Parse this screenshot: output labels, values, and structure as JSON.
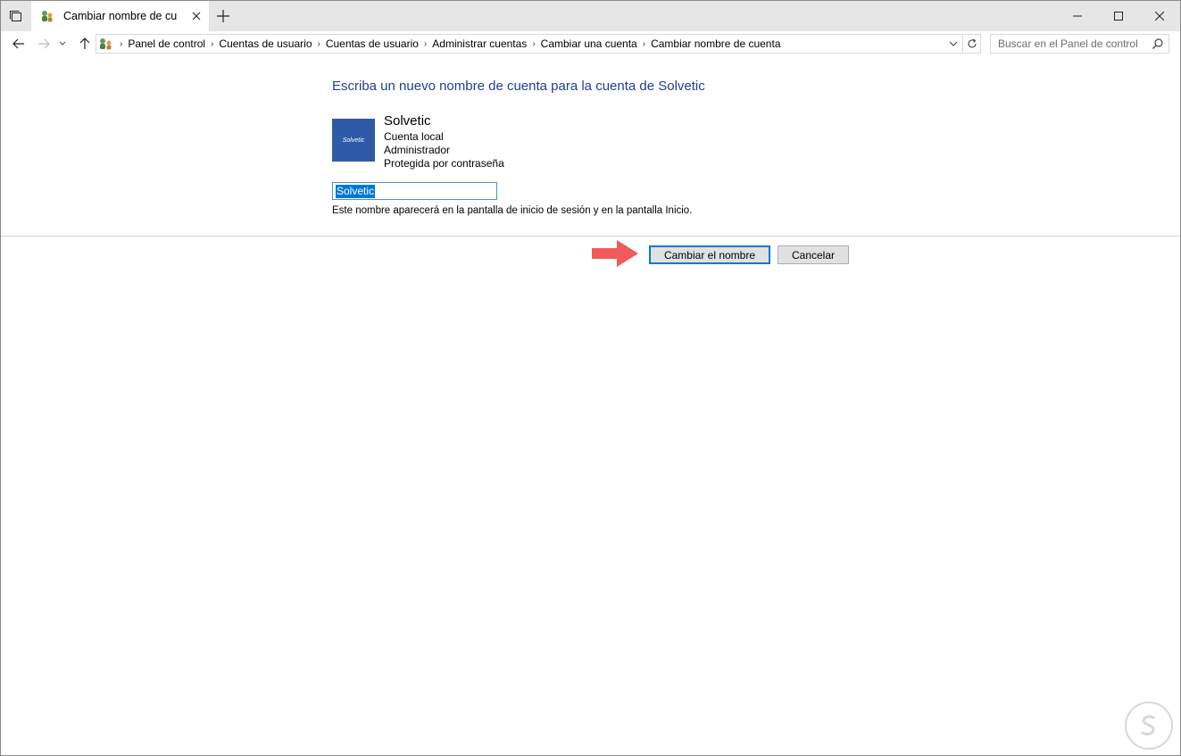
{
  "window": {
    "tab_title": "Cambiar nombre de cu",
    "controls": [
      "minimize",
      "maximize",
      "close"
    ]
  },
  "breadcrumb": [
    "Panel de control",
    "Cuentas de usuario",
    "Cuentas de usuario",
    "Administrar cuentas",
    "Cambiar una cuenta",
    "Cambiar nombre de cuenta"
  ],
  "search": {
    "placeholder": "Buscar en el Panel de control"
  },
  "content": {
    "heading": "Escriba un nuevo nombre de cuenta para la cuenta de Solvetic",
    "account": {
      "name": "Solvetic",
      "avatar_text": "Solvetic",
      "type": "Cuenta local",
      "role": "Administrador",
      "security": "Protegida por contraseña"
    },
    "name_input_value": "Solvetic",
    "hint": "Este nombre aparecerá en la pantalla de inicio de sesión y en la pantalla Inicio."
  },
  "buttons": {
    "rename": "Cambiar el nombre",
    "cancel": "Cancelar"
  },
  "colors": {
    "heading": "#1e3f94",
    "accent": "#0078d7",
    "avatar_bg": "#2f5aa8",
    "arrow": "#f05a5a"
  },
  "icons": {
    "tab_switcher": "tab-switcher-icon",
    "control_panel": "control-panel-icon",
    "close": "close-icon",
    "new_tab": "plus-icon",
    "back": "back-arrow-icon",
    "forward": "forward-arrow-icon",
    "recent": "chevron-down-icon",
    "up": "up-arrow-icon",
    "refresh": "refresh-icon",
    "search": "search-icon"
  }
}
